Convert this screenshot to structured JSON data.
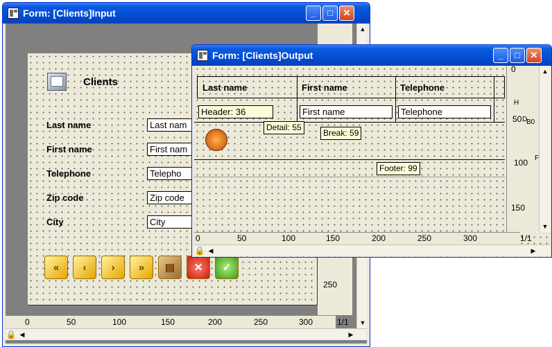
{
  "input_window": {
    "title": "Form: [Clients]Input",
    "form_title": "Clients",
    "labels": [
      "Last name",
      "First name",
      "Telephone",
      "Zip code",
      "City"
    ],
    "fields": [
      "Last nam",
      "First nam",
      "Telepho",
      "Zip code",
      "City"
    ],
    "ruler_h": [
      "0",
      "50",
      "100",
      "150",
      "200",
      "250",
      "300"
    ],
    "ruler_v": [
      "250"
    ],
    "page_indicator": "1/1"
  },
  "output_window": {
    "title": "Form: [Clients]Output",
    "columns": [
      "Last name",
      "First name",
      "Telephone"
    ],
    "fields": [
      "Header: 36",
      "First name",
      "Telephone"
    ],
    "markers": {
      "detail": "Detail: 55",
      "break": "Break: 59",
      "footer": "Footer: 99"
    },
    "ruler_h": [
      "0",
      "50",
      "100",
      "150",
      "200",
      "250",
      "300"
    ],
    "ruler_v": [
      "0",
      "50",
      "100",
      "150"
    ],
    "ruler_v_labels": {
      "h": "H",
      "d": "D",
      "b0": "B0",
      "f": "F"
    },
    "page_indicator": "1/1"
  },
  "colors": {
    "titlebar": "#0454d8",
    "form_bg": "#ece9d8",
    "marker_bg": "#fffcd8",
    "workspace": "#808080"
  }
}
